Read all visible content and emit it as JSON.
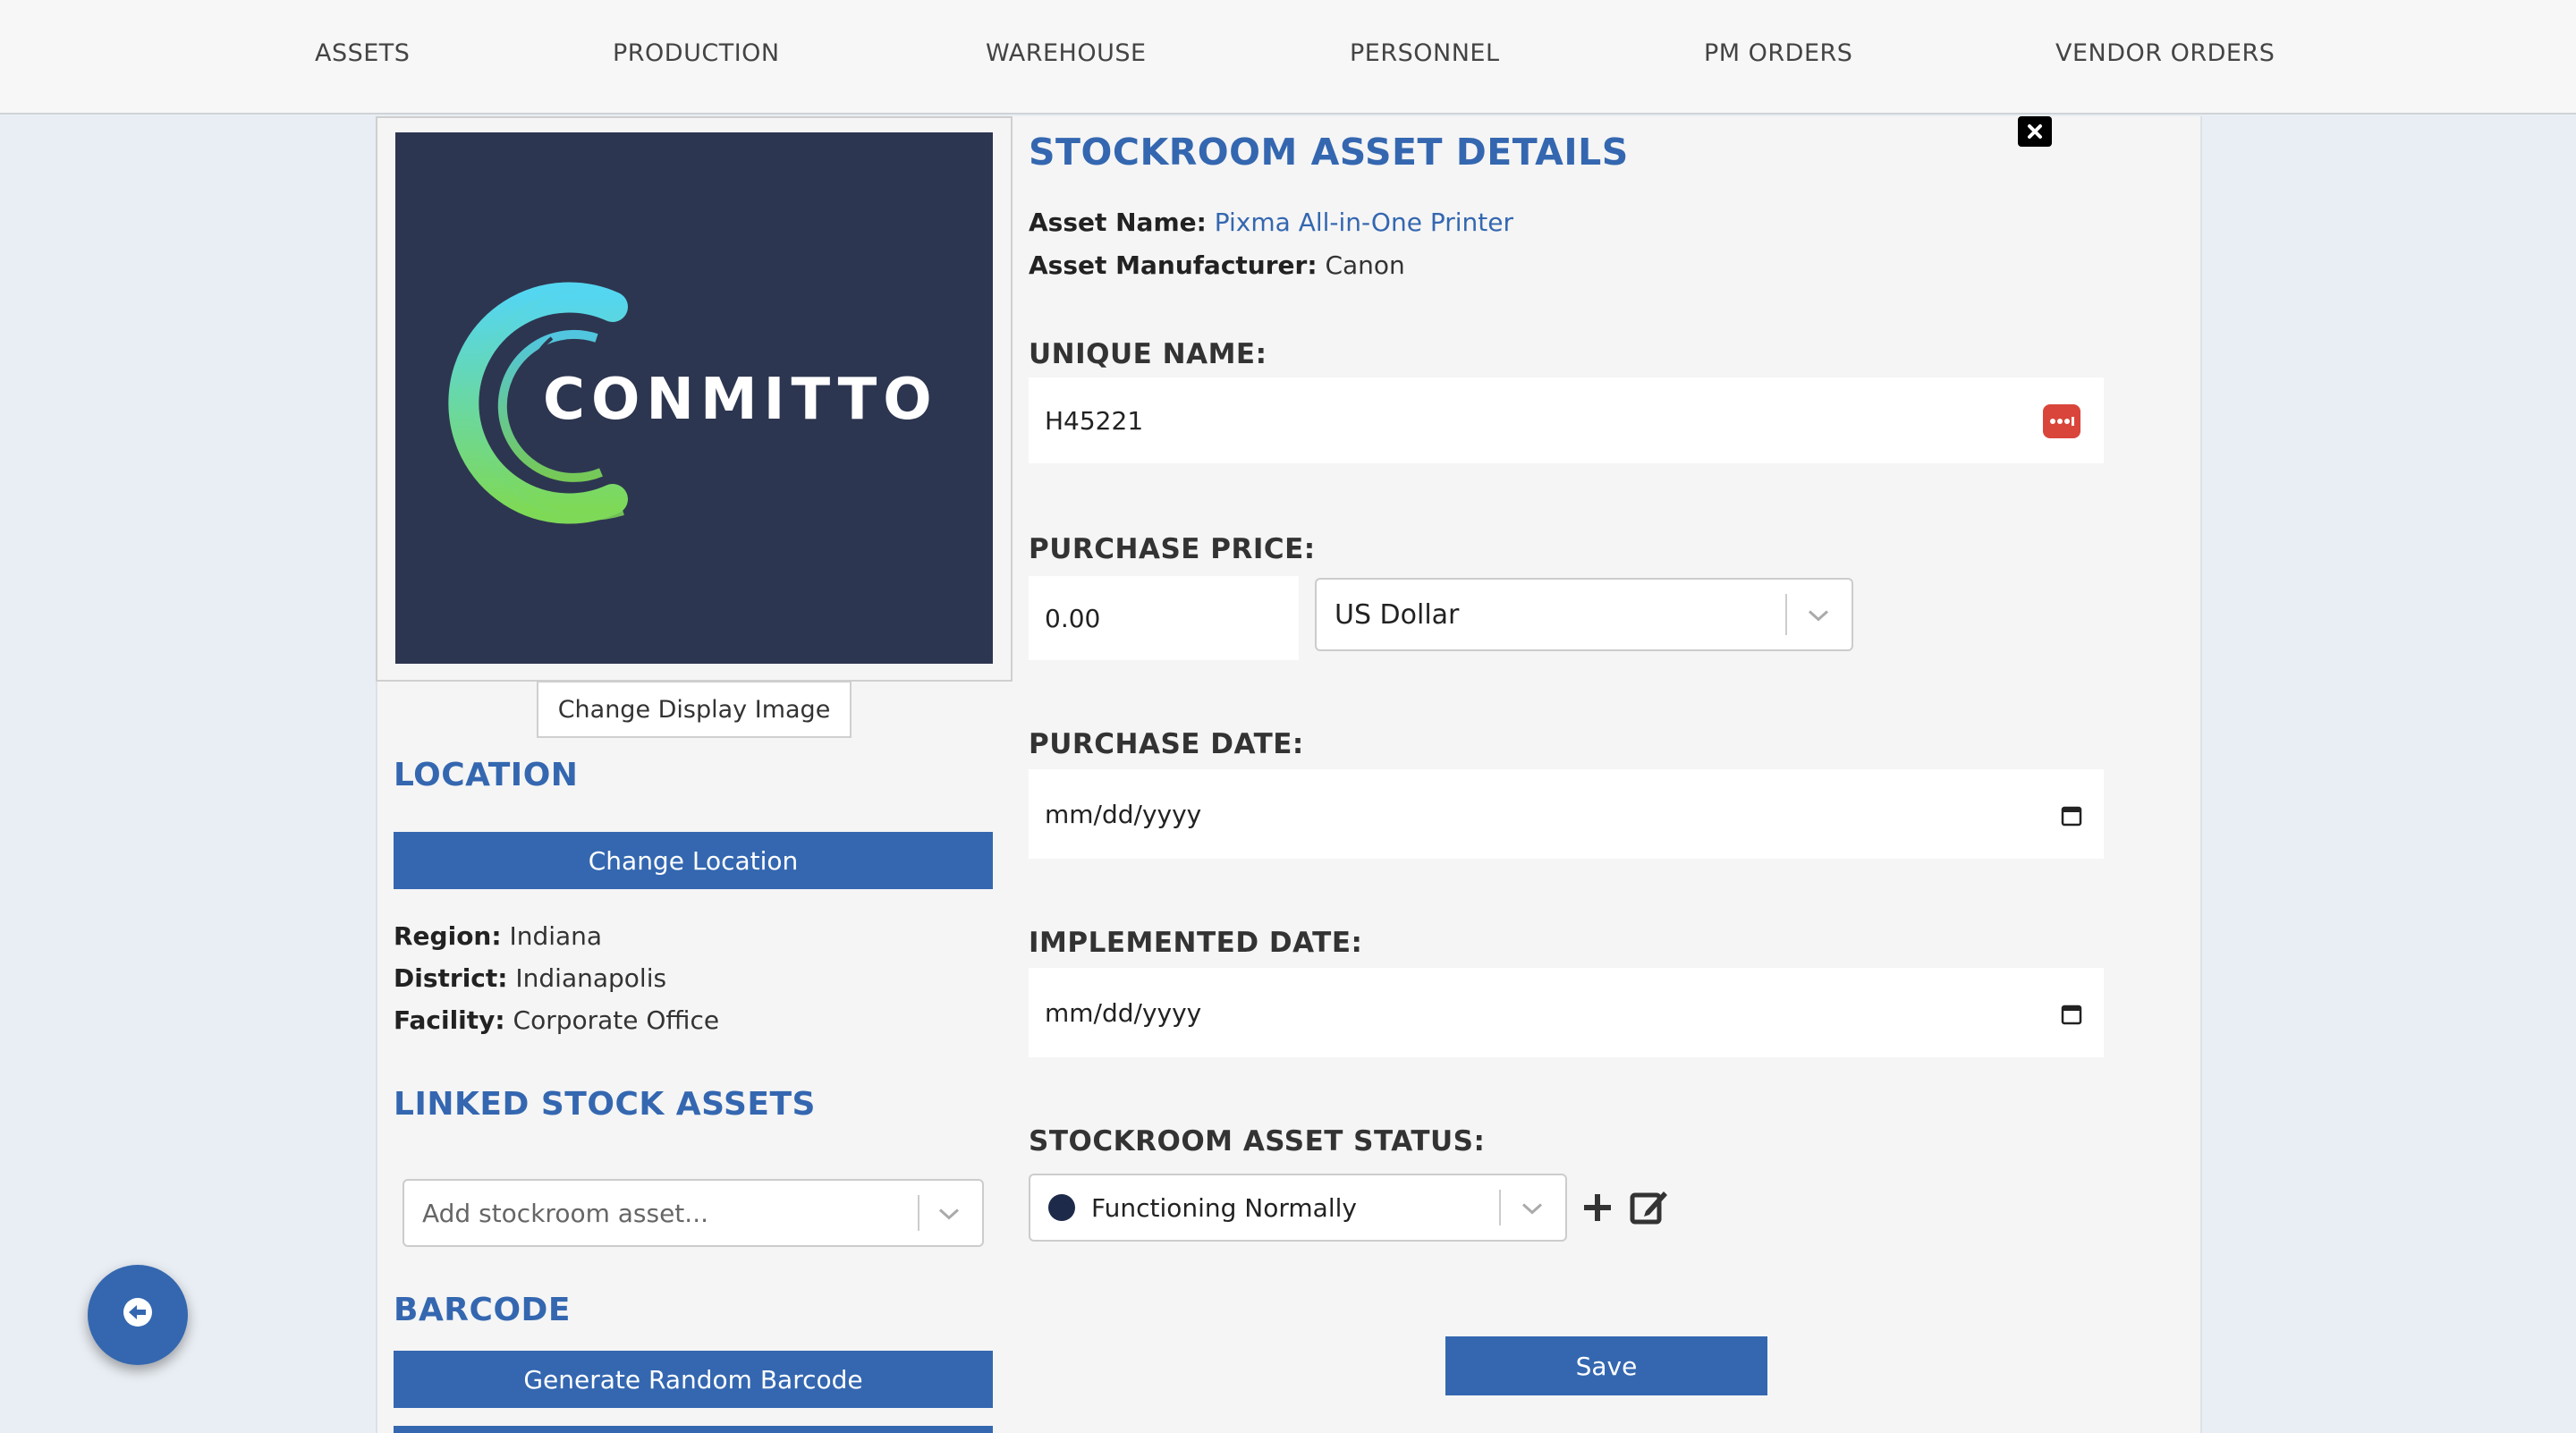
{
  "nav": {
    "items": [
      "ASSETS",
      "PRODUCTION",
      "WAREHOUSE",
      "PERSONNEL",
      "PM ORDERS",
      "VENDOR ORDERS"
    ]
  },
  "image": {
    "logo_text": "CONMITTO",
    "change_image_label": "Change Display Image"
  },
  "location": {
    "title": "LOCATION",
    "change_label": "Change Location",
    "region_label": "Region:",
    "region": "Indiana",
    "district_label": "District:",
    "district": "Indianapolis",
    "facility_label": "Facility:",
    "facility": "Corporate Office"
  },
  "linked": {
    "title": "LINKED STOCK ASSETS",
    "placeholder": "Add stockroom asset..."
  },
  "barcode": {
    "title": "BARCODE",
    "generate_label": "Generate Random Barcode"
  },
  "details": {
    "title": "STOCKROOM ASSET DETAILS",
    "asset_name_label": "Asset Name:",
    "asset_name": "Pixma All-in-One Printer",
    "manufacturer_label": "Asset Manufacturer:",
    "manufacturer": "Canon",
    "unique_name_label": "UNIQUE NAME:",
    "unique_name": "H45221",
    "purchase_price_label": "PURCHASE PRICE:",
    "purchase_price": "0.00",
    "currency": "US Dollar",
    "purchase_date_label": "PURCHASE DATE:",
    "purchase_date_placeholder": "mm/dd/yyyy",
    "implemented_date_label": "IMPLEMENTED DATE:",
    "implemented_date_placeholder": "mm/dd/yyyy",
    "status_label": "STOCKROOM ASSET STATUS:",
    "status": "Functioning Normally",
    "status_color": "#1e2a4a",
    "save_label": "Save"
  },
  "colors": {
    "accent": "#3467b0",
    "logo_bg": "#2d3650",
    "password_icon": "#d9453a"
  }
}
